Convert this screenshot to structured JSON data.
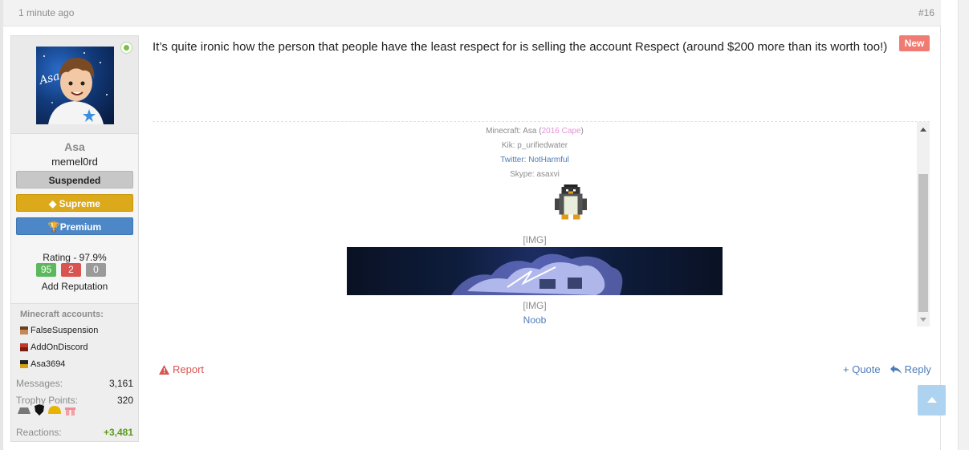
{
  "post": {
    "time": "1 minute ago",
    "number": "#16",
    "new_badge": "New",
    "message": "It’s quite ironic how the person that people have the least respect for is selling the account Respect (around $200 more than its worth too!)"
  },
  "user": {
    "name": "Asa",
    "title": "memel0rd",
    "banners": {
      "suspended": "Suspended",
      "supreme": "Supreme",
      "premium": "Premium"
    },
    "rating_label": "Rating - 97.9%",
    "rep_positive": "95",
    "rep_negative": "2",
    "rep_neutral": "0",
    "add_reputation": "Add Reputation",
    "minecraft_heading": "Minecraft accounts:",
    "minecraft_accounts": [
      "FalseSuspension",
      "AddOnDiscord",
      "Asa3694"
    ],
    "stats": {
      "messages_label": "Messages:",
      "messages_value": "3,161",
      "trophy_label": "Trophy Points:",
      "trophy_value": "320",
      "reactions_label": "Reactions:",
      "reactions_value": "+3,481"
    },
    "avatar_text": "Asa"
  },
  "signature": {
    "minecraft_prefix": "Minecraft: Asa (",
    "minecraft_cape": "2016 Cape",
    "minecraft_suffix": ")",
    "kik": "Kik: p_urifiedwater",
    "twitter_prefix": "Twitter: ",
    "twitter_handle": "NotHarmful",
    "skype": "Skype: asaxvi",
    "img_placeholder_1": "[IMG]",
    "img_placeholder_2": "[IMG]",
    "noob_link": "Noob"
  },
  "actions": {
    "report": "Report",
    "quote": "+ Quote",
    "reply": "Reply"
  },
  "colors": {
    "online": "#7bc043",
    "supreme": "#dca91a",
    "premium": "#4d87c7",
    "new_badge": "#f07b72",
    "link": "#4e7cb7",
    "report": "#d9534f"
  }
}
